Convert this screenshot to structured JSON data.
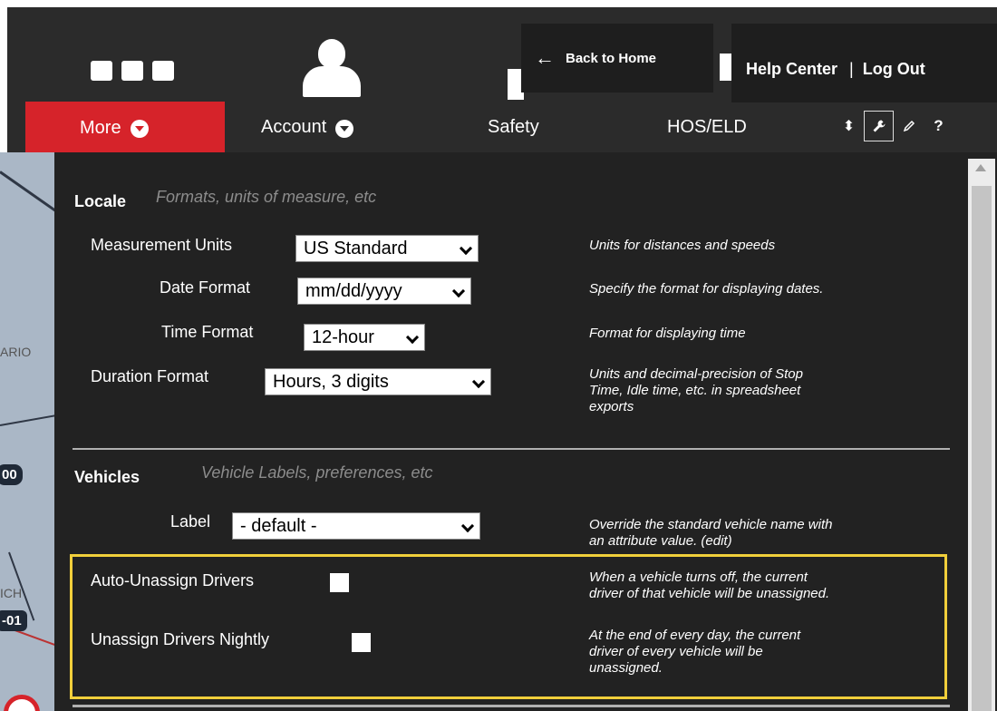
{
  "header": {
    "back_home": "Back to Home",
    "help_center": "Help Center",
    "separator": "|",
    "log_out": "Log Out"
  },
  "nav": {
    "more": "More",
    "account": "Account",
    "safety": "Safety",
    "hos": "HOS/ELD",
    "tools": [
      "sort-icon",
      "wrench-icon",
      "pencil-icon",
      "help-icon"
    ]
  },
  "map": {
    "labels": [
      "ARIO",
      "ICH"
    ],
    "badges": [
      "00",
      "-01"
    ]
  },
  "locale": {
    "title": "Locale",
    "subtitle": "Formats, units of measure, etc",
    "measurement_units": {
      "label": "Measurement Units",
      "value": "US Standard",
      "desc": "Units for distances and speeds"
    },
    "date_format": {
      "label": "Date Format",
      "value": "mm/dd/yyyy",
      "desc": "Specify the format for displaying dates."
    },
    "time_format": {
      "label": "Time Format",
      "value": "12-hour",
      "desc": "Format for displaying time"
    },
    "duration_format": {
      "label": "Duration Format",
      "value": "Hours, 3 digits",
      "desc1": "Units and decimal-precision of Stop",
      "desc2": "Time, Idle time, etc. in spreadsheet",
      "desc3": "exports"
    }
  },
  "vehicles": {
    "title": "Vehicles",
    "subtitle": "Vehicle Labels, preferences, etc",
    "label": {
      "label": "Label",
      "value": "- default -",
      "desc1": "Override the standard vehicle name with",
      "desc2": "an attribute value. (edit)"
    },
    "auto_unassign": {
      "label": "Auto-Unassign Drivers",
      "desc1": "When a vehicle turns off, the current",
      "desc2": "driver of that vehicle will be unassigned."
    },
    "unassign_nightly": {
      "label": "Unassign Drivers Nightly",
      "desc1": "At the end of every day, the current",
      "desc2": "driver of every vehicle will be",
      "desc3": "unassigned."
    }
  },
  "colors": {
    "accent": "#d6232a",
    "highlight": "#f1cf3b",
    "panel": "#222222"
  }
}
